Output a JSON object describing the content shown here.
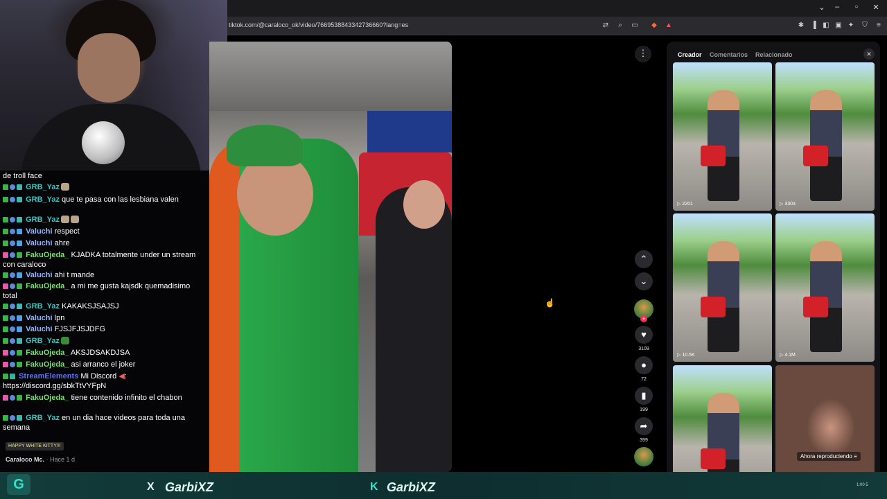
{
  "browser": {
    "url": "tiktok.com/@caraloco_ok/video/7669538843342736660?lang=es"
  },
  "chat": {
    "messages": [
      {
        "user": "",
        "text": "de troll face"
      },
      {
        "user": "GRB_Yaz",
        "text": ""
      },
      {
        "user": "GRB_Yaz",
        "text": "que te pasa con las lesbiana valen"
      },
      {
        "user": "GRB_Yaz",
        "text": ""
      },
      {
        "user": "Valuchi",
        "text": "respect"
      },
      {
        "user": "Valuchi",
        "text": "ahre"
      },
      {
        "user": "FakuOjeda_",
        "text": "KJADKA totalmente under un stream con caraloco"
      },
      {
        "user": "Valuchi",
        "text": "ahi t mande"
      },
      {
        "user": "FakuOjeda_",
        "text": "a mi me gusta kajsdk quemadisimo total"
      },
      {
        "user": "GRB_Yaz",
        "text": "KAKAKSJSAJSJ"
      },
      {
        "user": "Valuchi",
        "text": "lpn"
      },
      {
        "user": "Valuchi",
        "text": "FJSJFJSJDFG"
      },
      {
        "user": "GRB_Yaz",
        "text": ""
      },
      {
        "user": "FakuOjeda_",
        "text": "AKSJDSAKDJSA"
      },
      {
        "user": "FakuOjeda_",
        "text": "asi arranco el joker"
      },
      {
        "user": "StreamElements",
        "text": "Mi Discord",
        "text2": ": https://discord.gg/sbkTtVYFpN"
      },
      {
        "user": "FakuOjeda_",
        "text": "tiene contenido infinito el chabon"
      },
      {
        "user": "GRB_Yaz",
        "text": "en un dia hace videos para toda una semana"
      }
    ],
    "pinned": "HAPPY WHITE KITTY!!!",
    "creator": "Caraloco Mc.",
    "creator_time": "· Hace 1 d"
  },
  "video": {
    "likes": "3109",
    "comments": "72",
    "saves": "199",
    "shares": "399"
  },
  "panel": {
    "tabs": [
      "Creador",
      "Comentarios",
      "Relacionado"
    ],
    "active_tab": "Creador",
    "thumbnails": [
      {
        "views": "2201"
      },
      {
        "views": "3303"
      },
      {
        "views": "10.5K"
      },
      {
        "views": "4.1M"
      },
      {
        "views": ""
      },
      {
        "views": ""
      }
    ],
    "now_playing": "Ahora reproduciendo"
  },
  "overlay": {
    "twitter_handle": "GarbiXZ",
    "kick_handle": "GarbiXZ",
    "clock": "1:00 5"
  },
  "colors": {
    "accent_teal": "#35c7c3",
    "brand_kick": "#40e0c8",
    "tiktok_red": "#fe2c55"
  }
}
